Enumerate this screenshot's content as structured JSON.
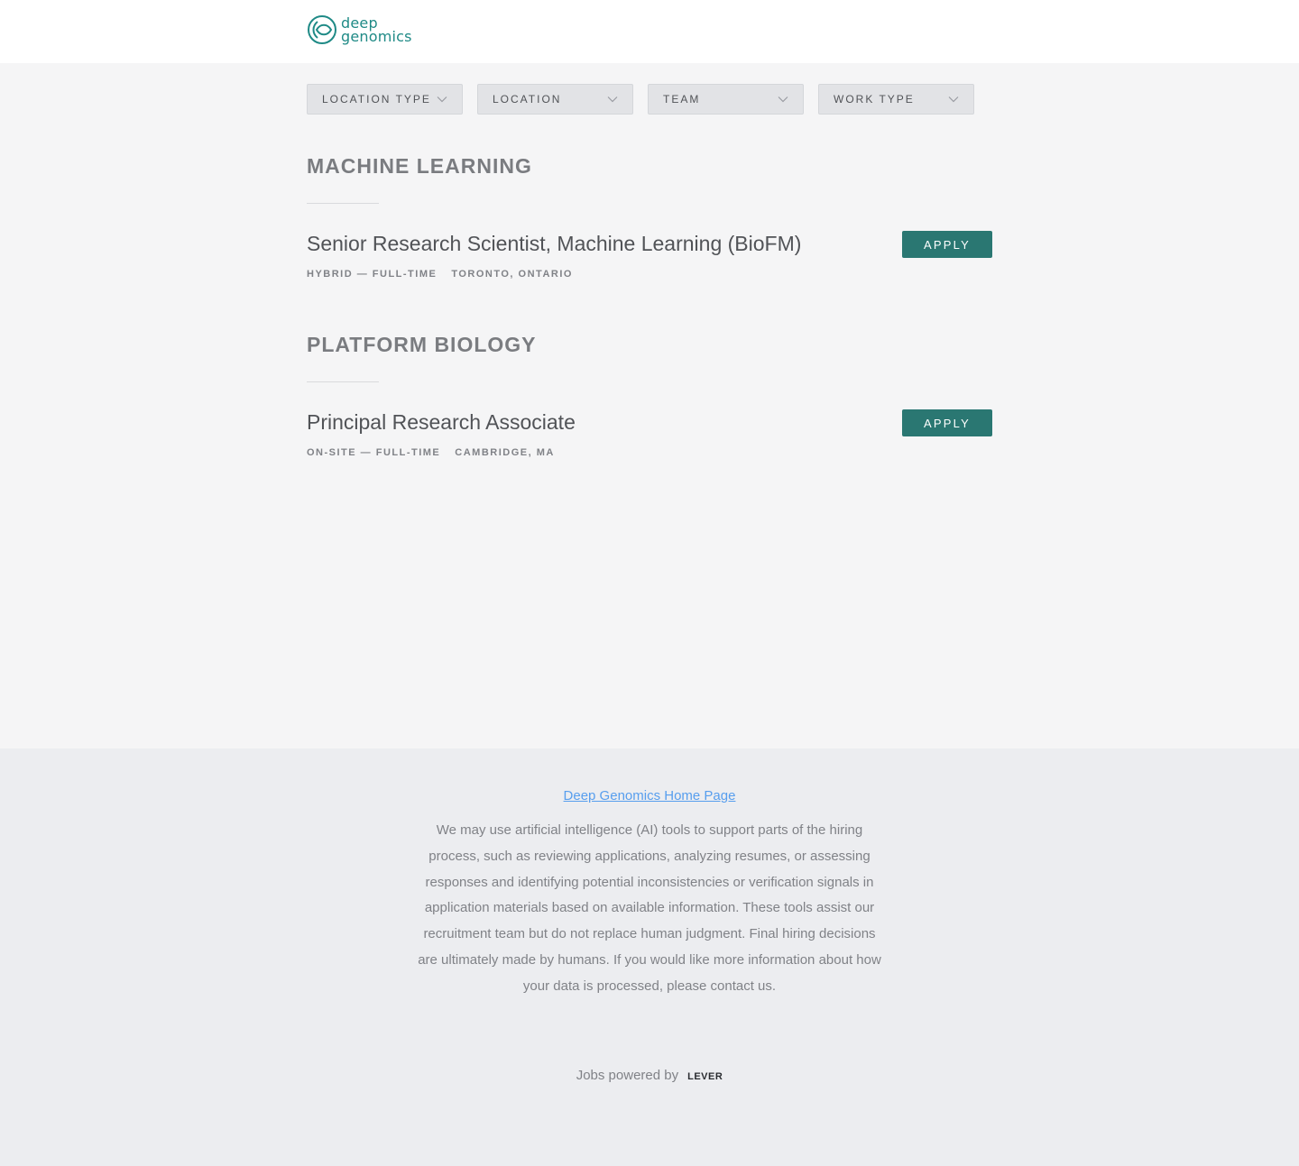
{
  "header": {
    "logo_line1": "deep",
    "logo_line2": "genomics"
  },
  "filters": [
    {
      "label": "LOCATION TYPE"
    },
    {
      "label": "LOCATION"
    },
    {
      "label": "TEAM"
    },
    {
      "label": "WORK TYPE"
    }
  ],
  "sections": [
    {
      "title": "MACHINE LEARNING",
      "posting": {
        "title": "Senior Research Scientist, Machine Learning (BioFM)",
        "work_type": "HYBRID — FULL-TIME",
        "location": "TORONTO, ONTARIO",
        "apply_label": "APPLY"
      }
    },
    {
      "title": "PLATFORM BIOLOGY",
      "posting": {
        "title": "Principal Research Associate",
        "work_type": "ON-SITE — FULL-TIME",
        "location": "CAMBRIDGE, MA",
        "apply_label": "APPLY"
      }
    }
  ],
  "footer": {
    "home_link": "Deep Genomics Home Page",
    "ai_note": "We may use artificial intelligence (AI) tools to support parts of the hiring process, such as reviewing applications, analyzing resumes, or assessing responses and identifying potential inconsistencies or verification signals in application materials based on available information. These tools assist our recruitment team but do not replace human judgment. Final hiring decisions are ultimately made by humans. If you would like more information about how your data is processed, please contact us.",
    "powered_by": "Jobs powered by",
    "lever_logo": "LEVER"
  },
  "colors": {
    "brand_teal": "#1f8a86",
    "apply_button": "#2a7772",
    "link_blue": "#579eee"
  }
}
